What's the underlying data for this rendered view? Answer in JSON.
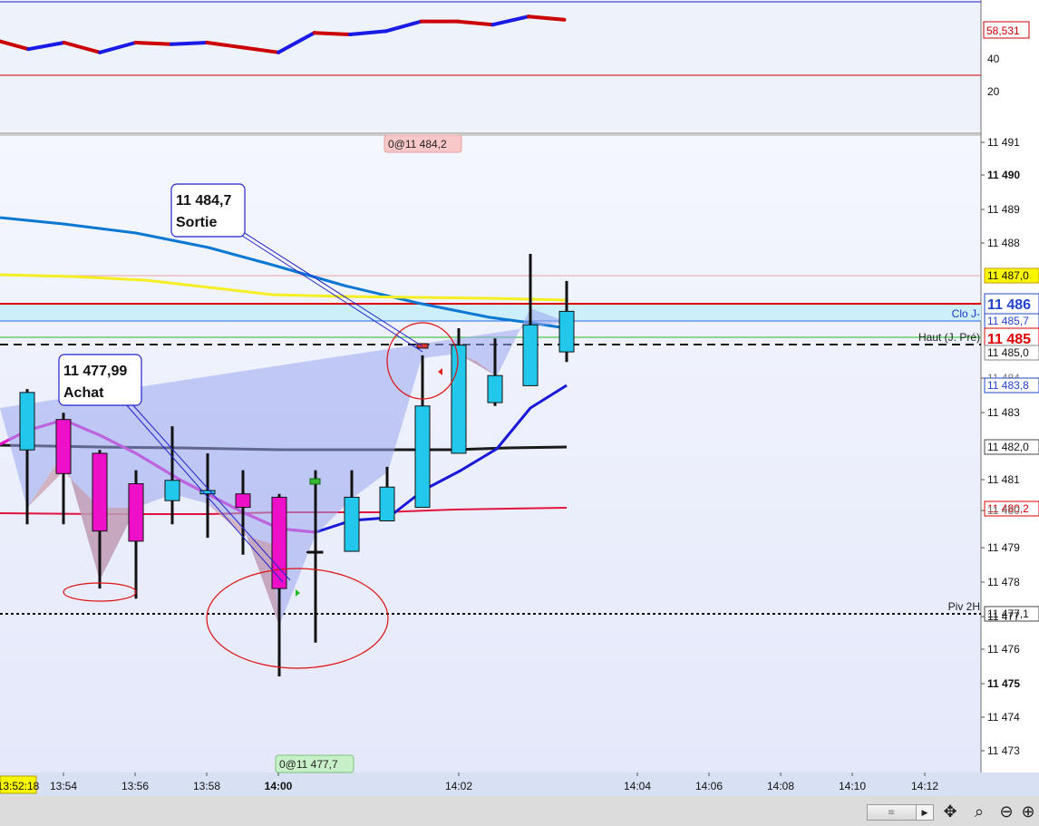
{
  "colors": {
    "panel_bg": "#eef2fb",
    "bull_body": "#22c8ec",
    "bear_body": "#ee10c8",
    "wick": "#111111",
    "rsi_up": "#1a1ae6",
    "rsi_down": "#cc0000",
    "ema_blue": "#0a78d2",
    "ema_yellow": "#f5ee22",
    "ema_black": "#1a1a1a",
    "ema_red": "#e0143c",
    "ema_navy": "#1818d8",
    "ema_magenta": "#ee10c8",
    "band": "#cdeefb",
    "annotation_red": "#dd1111"
  },
  "chart_data": [
    {
      "type": "line",
      "name": "oscillator",
      "ylim": [
        5,
        80
      ],
      "y_ticks": [
        "40",
        "20"
      ],
      "levels": [
        75,
        30
      ],
      "last_value_label": "58,531",
      "x": [
        "13:51",
        "13:52",
        "13:53",
        "13:54",
        "13:55",
        "13:56",
        "13:57",
        "13:58",
        "13:59",
        "14:00",
        "14:01",
        "14:02",
        "14:03",
        "14:04",
        "14:05",
        "14:06"
      ],
      "values": [
        52,
        46,
        50,
        44,
        50,
        49,
        50,
        47,
        44,
        56,
        55,
        57,
        63,
        63,
        61,
        66,
        64
      ],
      "value_offset": 0
    },
    {
      "type": "candlestick",
      "name": "price",
      "ylim": [
        11472.5,
        11491.8
      ],
      "y_ticks": [
        "11 491",
        "11 490",
        "11 489",
        "11 488",
        "11 487,0",
        "11 486",
        "11 485,7",
        "11 485",
        "11 485,0",
        "11 484",
        "11 483,8",
        "11 483",
        "11 482,0",
        "11 481",
        "11 480,2",
        "11 480",
        "11 479",
        "11 478",
        "11 477,1",
        "11 477",
        "11 476",
        "11 475",
        "11 474",
        "11 473"
      ],
      "x_ticks": [
        "13:52:18",
        "13:54",
        "13:56",
        "13:58",
        "14:00",
        "14:02",
        "14:04",
        "14:06",
        "14:08",
        "14:10",
        "14:12"
      ],
      "candles": [
        {
          "t": "13:52:30",
          "o": 11481.9,
          "h": 11483.7,
          "l": 11479.7,
          "c": 11483.6
        },
        {
          "t": "13:53:30",
          "o": 11482.8,
          "h": 11483.0,
          "l": 11479.7,
          "c": 11481.2
        },
        {
          "t": "13:54:30",
          "o": 11481.8,
          "h": 11481.9,
          "l": 11477.8,
          "c": 11479.5
        },
        {
          "t": "13:55:30",
          "o": 11480.9,
          "h": 11481.3,
          "l": 11477.5,
          "c": 11479.2
        },
        {
          "t": "13:56:30",
          "o": 11480.4,
          "h": 11482.6,
          "l": 11479.7,
          "c": 11481.0
        },
        {
          "t": "13:57:30",
          "o": 11480.6,
          "h": 11481.8,
          "l": 11479.3,
          "c": 11480.7
        },
        {
          "t": "13:58:30",
          "o": 11480.6,
          "h": 11481.3,
          "l": 11478.8,
          "c": 11480.2
        },
        {
          "t": "13:59:30",
          "o": 11480.5,
          "h": 11480.6,
          "l": 11475.2,
          "c": 11477.8
        },
        {
          "t": "14:00:30",
          "o": 11478.9,
          "h": 11481.3,
          "l": 11476.2,
          "c": 11478.9
        },
        {
          "t": "14:01:00",
          "o": 11478.9,
          "h": 11481.3,
          "l": 11478.9,
          "c": 11480.5
        },
        {
          "t": "14:01:30",
          "o": 11479.8,
          "h": 11481.4,
          "l": 11479.8,
          "c": 11480.8
        },
        {
          "t": "14:02:00",
          "o": 11480.2,
          "h": 11484.7,
          "l": 11480.2,
          "c": 11483.2
        },
        {
          "t": "14:02:30",
          "o": 11481.8,
          "h": 11485.5,
          "l": 11481.8,
          "c": 11485.0
        },
        {
          "t": "14:03:00",
          "o": 11483.3,
          "h": 11485.2,
          "l": 11483.2,
          "c": 11484.1
        },
        {
          "t": "14:03:30",
          "o": 11483.8,
          "h": 11487.7,
          "l": 11483.8,
          "c": 11485.6
        },
        {
          "t": "14:04:00",
          "o": 11484.8,
          "h": 11486.9,
          "l": 11484.5,
          "c": 11486.0
        }
      ],
      "markers": {
        "top_label": "0@11 484,2",
        "bottom_label": "0@11 477,7"
      },
      "levels": [
        {
          "value": 11487.0,
          "label": "11 487,0",
          "name": "",
          "style": "thin-pink"
        },
        {
          "value": 11486.0,
          "label": "11 486",
          "name": "",
          "style": "red"
        },
        {
          "value": 11485.7,
          "label": "11 485,7",
          "name": "Clo J-",
          "style": "blue"
        },
        {
          "value": 11485.2,
          "label": "11 485",
          "name": "Haut (J. Pré)",
          "style": "green"
        },
        {
          "value": 11485.0,
          "label": "11 485,0",
          "name": "",
          "style": "dashed"
        },
        {
          "value": 11477.1,
          "label": "11 477,1",
          "name": "Piv 2H",
          "style": "dotted"
        }
      ],
      "callouts": [
        {
          "value": "11 484,7",
          "text": "Sortie"
        },
        {
          "value": "11 477,99",
          "text": "Achat"
        }
      ]
    }
  ],
  "toolbar": {
    "scroll_grip": "≡",
    "scroll_right": "▶",
    "tools": [
      {
        "name": "crosshair-tool-icon",
        "glyph": "✥"
      },
      {
        "name": "zoom-fit-icon",
        "glyph": "⌕"
      },
      {
        "name": "zoom-out-icon",
        "glyph": "⊖"
      },
      {
        "name": "zoom-in-icon",
        "glyph": "⊕"
      }
    ]
  }
}
